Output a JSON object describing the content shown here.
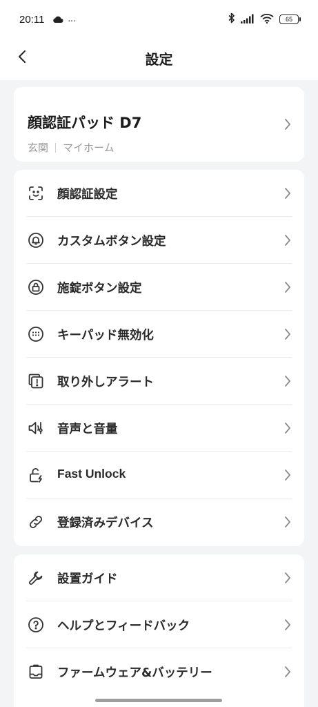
{
  "status_bar": {
    "time": "20:11",
    "more": "···",
    "battery": "65"
  },
  "nav": {
    "title": "設定"
  },
  "device": {
    "name": "顔認証パッド D7",
    "location": "玄関",
    "home": "マイホーム"
  },
  "settings": {
    "items": [
      {
        "label": "顔認証設定",
        "icon": "face-scan-icon"
      },
      {
        "label": "カスタムボタン設定",
        "icon": "bell-icon"
      },
      {
        "label": "施錠ボタン設定",
        "icon": "lock-icon"
      },
      {
        "label": "キーパッド無効化",
        "icon": "keypad-icon"
      },
      {
        "label": "取り外しアラート",
        "icon": "alert-icon"
      },
      {
        "label": "音声と音量",
        "icon": "speaker-icon"
      },
      {
        "label": "Fast Unlock",
        "icon": "unlock-icon"
      },
      {
        "label": "登録済みデバイス",
        "icon": "link-icon"
      }
    ]
  },
  "help": {
    "items": [
      {
        "label": "設置ガイド",
        "icon": "wrench-icon"
      },
      {
        "label": "ヘルプとフィードバック",
        "icon": "question-icon"
      },
      {
        "label": "ファームウェア&バッテリー",
        "icon": "firmware-icon"
      }
    ]
  },
  "colors": {
    "background": "#f3f4f6",
    "card": "#ffffff",
    "text": "#2a2a2a",
    "secondary": "#9a9a9a"
  }
}
